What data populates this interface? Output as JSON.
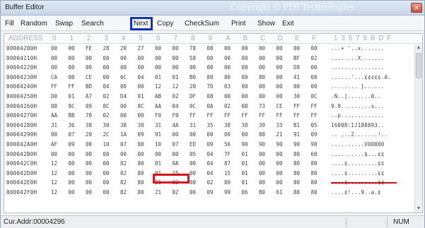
{
  "window": {
    "title": "Buffer Editor",
    "watermark": "Copyright © PDI Technologies",
    "close_glyph": "✕"
  },
  "menu": [
    "Fill",
    "Random",
    "Swap",
    "Search",
    "Next",
    "Copy",
    "CheckSum",
    "Print",
    "Show",
    "Exit"
  ],
  "highlight": {
    "menu_box_color": "#1334b8",
    "value_box_color": "#d4141f"
  },
  "columns": {
    "address_label": "ADDRESS",
    "hex": [
      "0",
      "1",
      "2",
      "3",
      "4",
      "5",
      "6",
      "7",
      "8",
      "9",
      "A",
      "B",
      "C",
      "D",
      "E",
      "F"
    ],
    "ascii_label": "1 3 5 7 9 B D F"
  },
  "rows": [
    {
      "addr": "00004200H",
      "bytes": [
        "00",
        "00",
        "FE",
        "28",
        "20",
        "27",
        "00",
        "00",
        "78",
        "00",
        "00",
        "00",
        "00",
        "00",
        "00",
        "00"
      ],
      "ascii": "...+ '..x......."
    },
    {
      "addr": "00004210H",
      "bytes": [
        "00",
        "00",
        "00",
        "00",
        "00",
        "00",
        "00",
        "00",
        "58",
        "00",
        "00",
        "00",
        "00",
        "00",
        "BF",
        "02"
      ],
      "ascii": "........X......."
    },
    {
      "addr": "00004220H",
      "bytes": [
        "00",
        "00",
        "00",
        "00",
        "00",
        "00",
        "00",
        "00",
        "00",
        "00",
        "00",
        "00",
        "00",
        "00",
        "D8",
        "00"
      ],
      "ascii": "................"
    },
    {
      "addr": "00004230H",
      "bytes": [
        "CA",
        "00",
        "CE",
        "00",
        "6C",
        "04",
        "01",
        "01",
        "B0",
        "80",
        "80",
        "80",
        "80",
        "00",
        "41",
        "08"
      ],
      "ascii": "......'...¢¢¢¢¢.A."
    },
    {
      "addr": "00004240H",
      "bytes": [
        "FF",
        "FF",
        "BD",
        "04",
        "00",
        "00",
        "12",
        "12",
        "20",
        "7D",
        "03",
        "00",
        "00",
        "00",
        "00",
        "00"
      ],
      "ascii": "........ }......"
    },
    {
      "addr": "00004250H",
      "bytes": [
        "D0",
        "01",
        "A7",
        "02",
        "D4",
        "01",
        "AB",
        "02",
        "DF",
        "08",
        "00",
        "00",
        "00",
        "00",
        "30",
        "0C"
      ],
      "ascii": ".N..[.......0.."
    },
    {
      "addr": "00004260H",
      "bytes": [
        "08",
        "8C",
        "09",
        "8C",
        "00",
        "8C",
        "AA",
        "04",
        "0C",
        "0A",
        "02",
        "08",
        "73",
        "CE",
        "FF",
        "FF"
      ],
      "ascii": "9.9.........s..."
    },
    {
      "addr": "00004270H",
      "bytes": [
        "AA",
        "BB",
        "70",
        "02",
        "00",
        "00",
        "F0",
        "F0",
        "FF",
        "FF",
        "FF",
        "FF",
        "FF",
        "FF",
        "FF",
        "FF"
      ],
      "ascii": "..p............."
    },
    {
      "addr": "00004280H",
      "bytes": [
        "31",
        "36",
        "38",
        "30",
        "38",
        "38",
        "31",
        "4A",
        "31",
        "35",
        "38",
        "38",
        "39",
        "33",
        "B1",
        "05"
      ],
      "ascii": "16808:1J188893.."
    },
    {
      "addr": "00004290H",
      "bytes": [
        "00",
        "07",
        "20",
        "2C",
        "1A",
        "09",
        "91",
        "00",
        "00",
        "00",
        "00",
        "00",
        "88",
        "21",
        "91",
        "09"
      ],
      "ascii": ".. ,..2.......!.."
    },
    {
      "addr": "000042A0H",
      "bytes": [
        "AF",
        "09",
        "00",
        "10",
        "07",
        "00",
        "10",
        "07",
        "ED",
        "09",
        "56",
        "90",
        "90",
        "90",
        "90",
        "90"
      ],
      "ascii": "..........V00000"
    },
    {
      "addr": "000042B0H",
      "bytes": [
        "00",
        "00",
        "00",
        "00",
        "00",
        "00",
        "00",
        "00",
        "05",
        "04",
        "7F",
        "01",
        "00",
        "00",
        "80",
        "60"
      ],
      "ascii": "..........$...¢¢"
    },
    {
      "addr": "000042C0H",
      "bytes": [
        "12",
        "00",
        "00",
        "00",
        "82",
        "80",
        "01",
        "0A",
        "00",
        "04",
        "87",
        "01",
        "00",
        "00",
        "80",
        "80"
      ],
      "ascii": "....¢.........¢¢"
    },
    {
      "addr": "000042D0H",
      "bytes": [
        "12",
        "00",
        "00",
        "00",
        "82",
        "80",
        "01",
        "15",
        "00",
        "04",
        "15",
        "01",
        "00",
        "00",
        "80",
        "80"
      ],
      "ascii": "....¢.........¢¢"
    },
    {
      "addr": "000042E0H",
      "bytes": [
        "12",
        "00",
        "00",
        "00",
        "82",
        "80",
        "01",
        "02",
        "00",
        "02",
        "80",
        "01",
        "00",
        "00",
        "80",
        "80"
      ],
      "ascii": "....¢.........¢¢"
    },
    {
      "addr": "000042F0H",
      "bytes": [
        "12",
        "00",
        "00",
        "00",
        "82",
        "80",
        "21",
        "02",
        "00",
        "09",
        "99",
        "06",
        "B0",
        "61",
        "88",
        "80"
      ],
      "ascii": "....¢!...9..a.¢"
    }
  ],
  "selected_value": "09 91",
  "selected_ascii_run": "16808:1J188893",
  "status": {
    "address": "Cur.Addr:00004296",
    "num": "NUM"
  }
}
